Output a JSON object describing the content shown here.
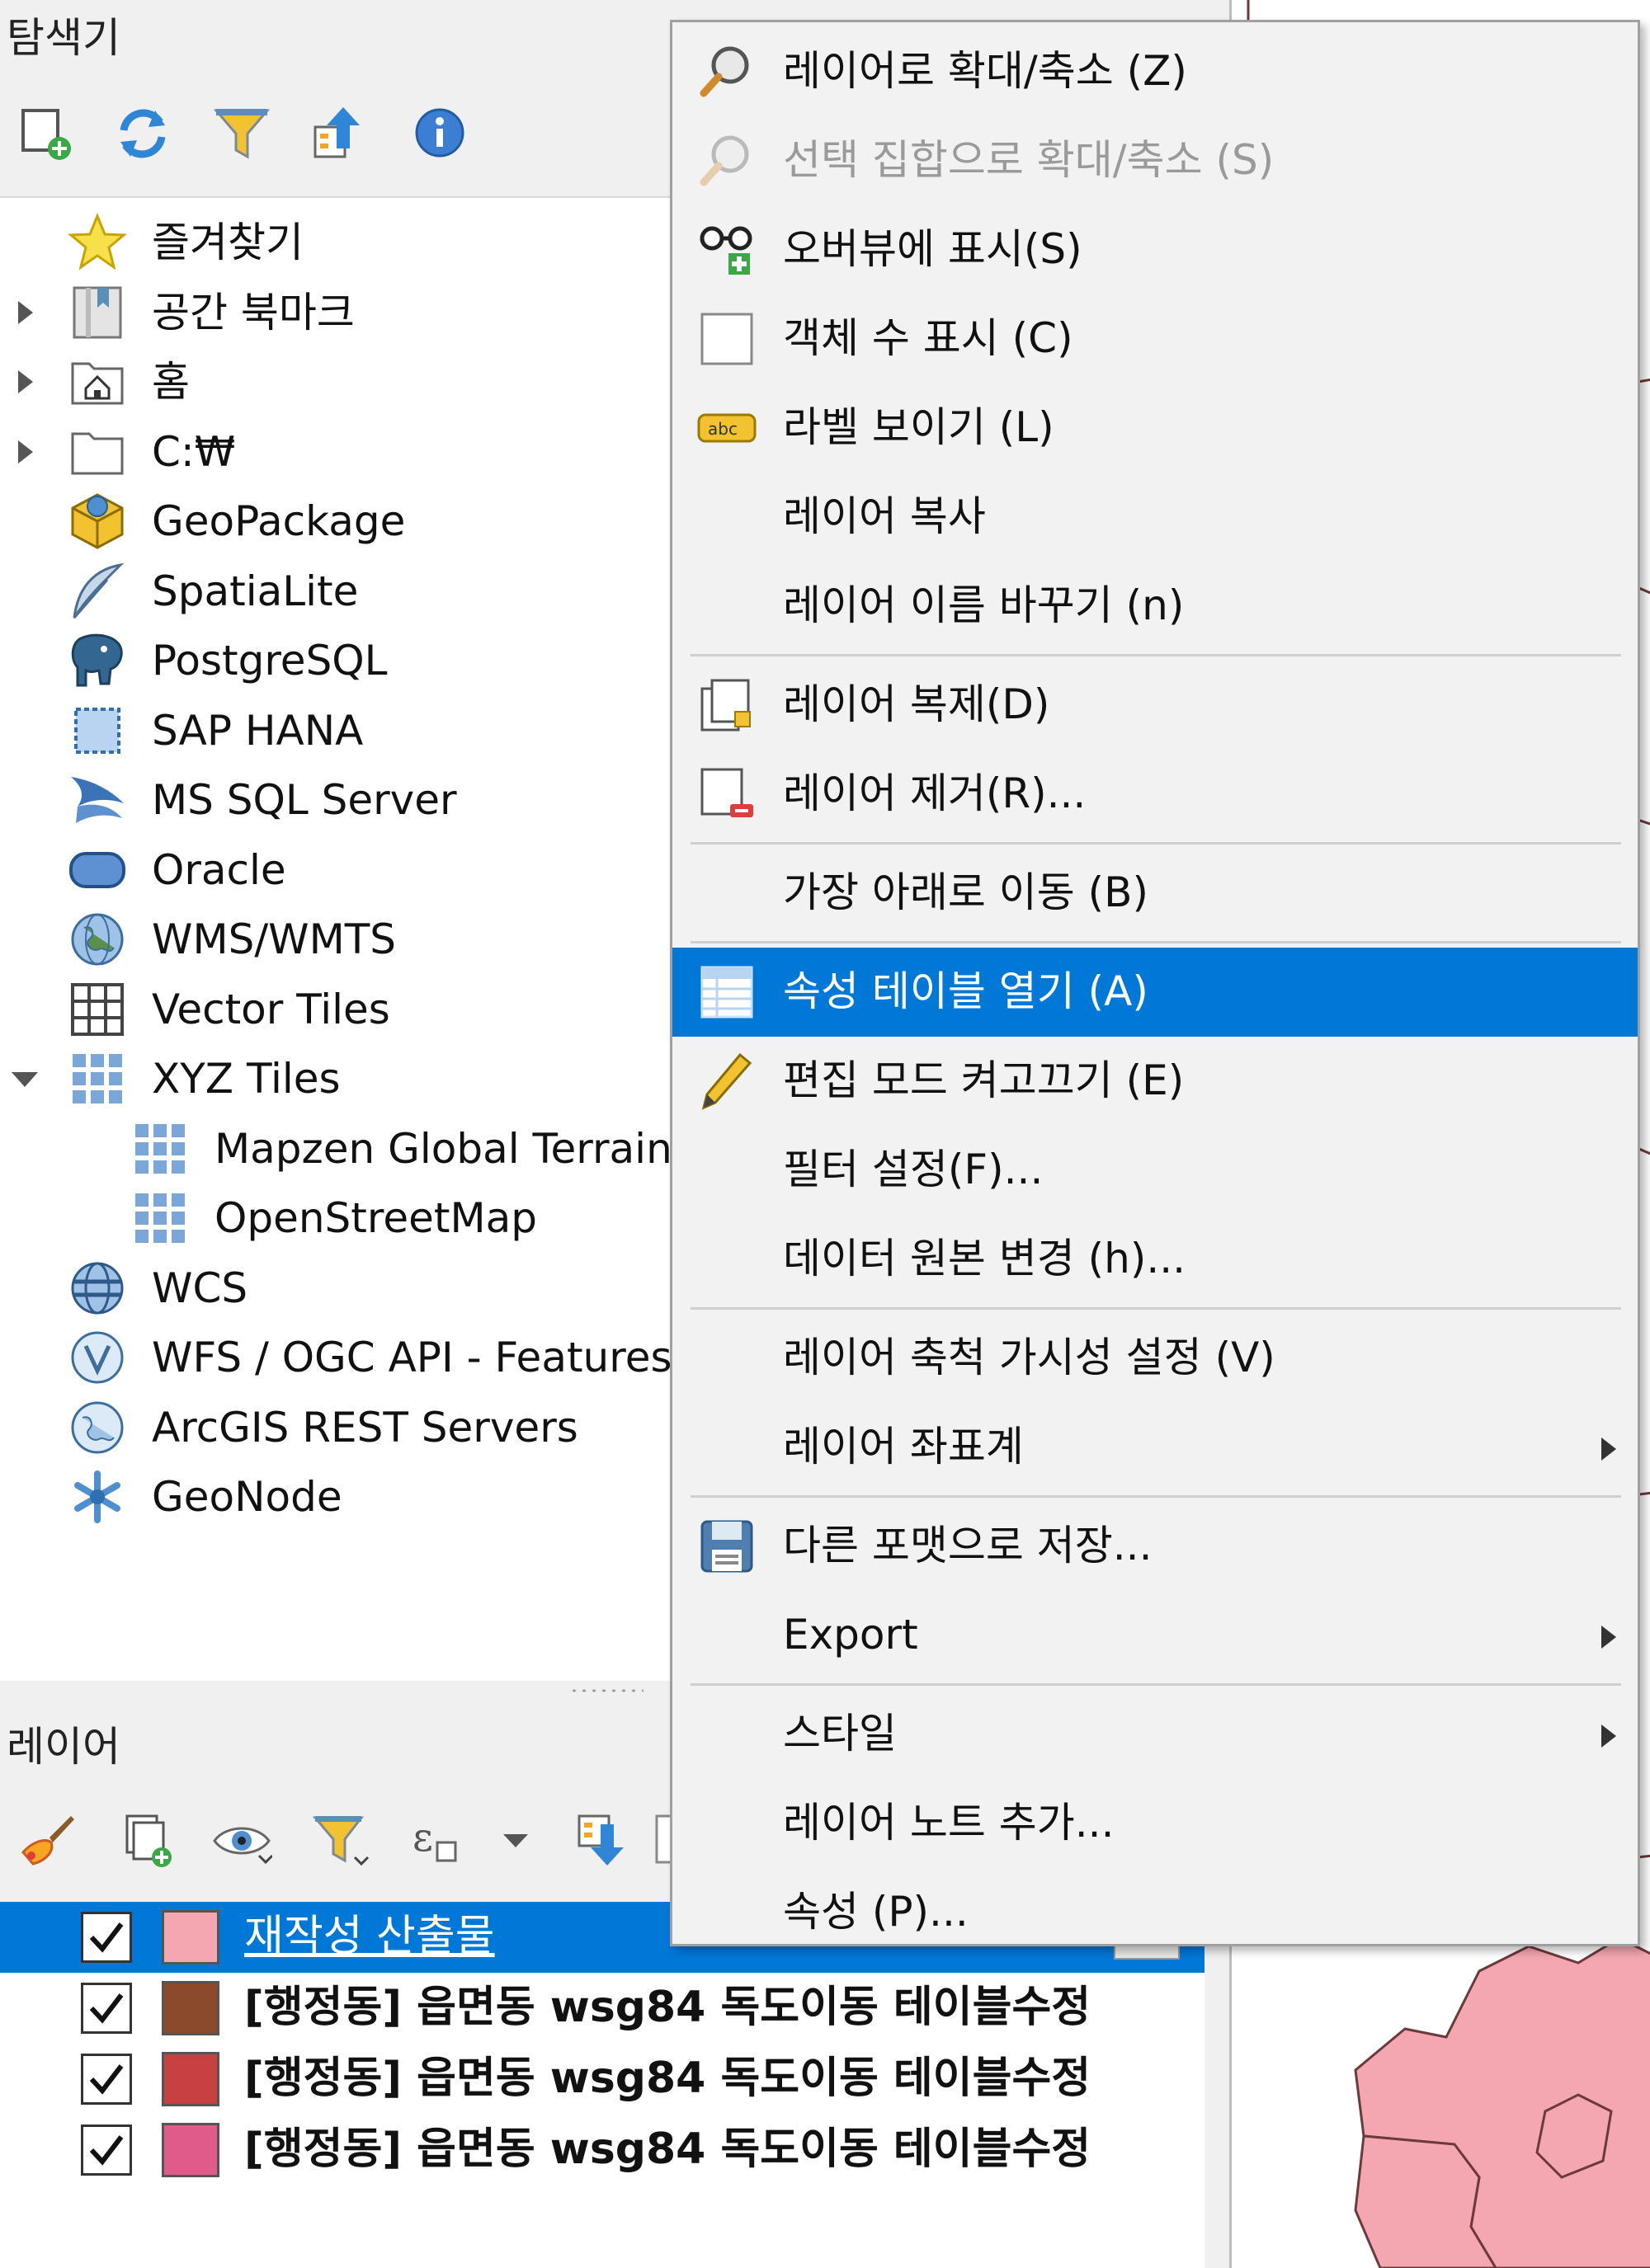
{
  "browser": {
    "title": "탐색기",
    "toolbar": [
      "add-layer-icon",
      "refresh-icon",
      "filter-icon",
      "collapse-all-icon",
      "info-icon"
    ],
    "items": [
      {
        "label": "즐겨찾기",
        "icon": "star-icon",
        "arrow": "none",
        "depth": 0
      },
      {
        "label": "공간 북마크",
        "icon": "bookmark-icon",
        "arrow": "collapsed",
        "depth": 0
      },
      {
        "label": "홈",
        "icon": "home-folder-icon",
        "arrow": "collapsed",
        "depth": 0
      },
      {
        "label": "C:₩",
        "icon": "folder-icon",
        "arrow": "collapsed",
        "depth": 0
      },
      {
        "label": "GeoPackage",
        "icon": "geopackage-icon",
        "arrow": "none",
        "depth": 0
      },
      {
        "label": "SpatiaLite",
        "icon": "feather-icon",
        "arrow": "none",
        "depth": 0
      },
      {
        "label": "PostgreSQL",
        "icon": "elephant-icon",
        "arrow": "none",
        "depth": 0
      },
      {
        "label": "SAP HANA",
        "icon": "hana-icon",
        "arrow": "none",
        "depth": 0
      },
      {
        "label": "MS SQL Server",
        "icon": "mssql-icon",
        "arrow": "none",
        "depth": 0
      },
      {
        "label": "Oracle",
        "icon": "oracle-icon",
        "arrow": "none",
        "depth": 0
      },
      {
        "label": "WMS/WMTS",
        "icon": "globe-icon",
        "arrow": "none",
        "depth": 0
      },
      {
        "label": "Vector Tiles",
        "icon": "vector-tiles-icon",
        "arrow": "none",
        "depth": 0
      },
      {
        "label": "XYZ Tiles",
        "icon": "xyz-tiles-icon",
        "arrow": "expanded",
        "depth": 0
      },
      {
        "label": "Mapzen Global Terrain",
        "icon": "xyz-tiles-icon",
        "arrow": "none",
        "depth": 1
      },
      {
        "label": "OpenStreetMap",
        "icon": "xyz-tiles-icon",
        "arrow": "none",
        "depth": 1
      },
      {
        "label": "WCS",
        "icon": "wcs-globe-icon",
        "arrow": "none",
        "depth": 0
      },
      {
        "label": "WFS / OGC API - Features",
        "icon": "wfs-globe-icon",
        "arrow": "none",
        "depth": 0
      },
      {
        "label": "ArcGIS REST Servers",
        "icon": "arcgis-globe-icon",
        "arrow": "none",
        "depth": 0
      },
      {
        "label": "GeoNode",
        "icon": "geonode-icon",
        "arrow": "none",
        "depth": 0
      }
    ]
  },
  "layers_panel": {
    "title": "레이어",
    "toolbar": [
      "style-brush-icon",
      "add-group-icon",
      "eye-icon",
      "filter-legend-icon",
      "expression-filter-icon",
      "dropdown-arrow-icon",
      "expand-all-icon",
      "collapse-icon"
    ],
    "layers": [
      {
        "label": "재작성 산출물",
        "color": "#f4a7b0",
        "checked": true,
        "selected": true
      },
      {
        "label": "[행정동] 읍면동 wsg84 독도이동 테이블수정",
        "color": "#8b4a2b",
        "checked": true,
        "selected": false
      },
      {
        "label": "[행정동] 읍면동 wsg84 독도이동 테이블수정",
        "color": "#c94040",
        "checked": true,
        "selected": false
      },
      {
        "label": "[행정동] 읍면동 wsg84 독도이동 테이블수정",
        "color": "#e05a8a",
        "checked": true,
        "selected": false
      }
    ]
  },
  "context_menu": {
    "items": [
      {
        "label": "레이어로 확대/축소 (Z)",
        "icon": "zoom-icon",
        "state": "normal"
      },
      {
        "label": "선택 집합으로 확대/축소 (S)",
        "icon": "zoom-icon",
        "state": "disabled"
      },
      {
        "label": "오버뷰에 표시(S)",
        "icon": "overview-glasses-icon",
        "state": "normal"
      },
      {
        "label": "객체 수 표시 (C)",
        "icon": "checkbox-icon",
        "state": "normal"
      },
      {
        "label": "라벨 보이기 (L)",
        "icon": "label-abc-icon",
        "state": "normal"
      },
      {
        "label": "레이어 복사",
        "icon": "none",
        "state": "normal"
      },
      {
        "label": "레이어 이름 바꾸기 (n)",
        "icon": "none",
        "state": "normal",
        "sep_after": true
      },
      {
        "label": "레이어 복제(D)",
        "icon": "duplicate-layer-icon",
        "state": "normal"
      },
      {
        "label": "레이어 제거(R)...",
        "icon": "remove-layer-icon",
        "state": "normal",
        "sep_after": true
      },
      {
        "label": "가장 아래로 이동 (B)",
        "icon": "none",
        "state": "normal",
        "sep_after": true
      },
      {
        "label": "속성 테이블 열기 (A)",
        "icon": "attribute-table-icon",
        "state": "highlighted"
      },
      {
        "label": "편집 모드 켜고끄기 (E)",
        "icon": "pencil-icon",
        "state": "normal"
      },
      {
        "label": "필터 설정(F)...",
        "icon": "none",
        "state": "normal"
      },
      {
        "label": "데이터 원본 변경 (h)...",
        "icon": "none",
        "state": "normal",
        "sep_after": true
      },
      {
        "label": "레이어 축척 가시성 설정 (V)",
        "icon": "none",
        "state": "normal"
      },
      {
        "label": "레이어 좌표계",
        "icon": "none",
        "state": "normal",
        "submenu": true,
        "sep_after": true
      },
      {
        "label": "다른 포맷으로 저장...",
        "icon": "save-icon",
        "state": "normal"
      },
      {
        "label": "Export",
        "icon": "none",
        "state": "normal",
        "submenu": true,
        "sep_after": true
      },
      {
        "label": "스타일",
        "icon": "none",
        "state": "normal",
        "submenu": true
      },
      {
        "label": "레이어 노트 추가...",
        "icon": "none",
        "state": "normal"
      },
      {
        "label": "속성 (P)...",
        "icon": "none",
        "state": "normal"
      }
    ]
  },
  "colors": {
    "selection": "#0078d7",
    "map_fill": "#f4a7b0"
  }
}
